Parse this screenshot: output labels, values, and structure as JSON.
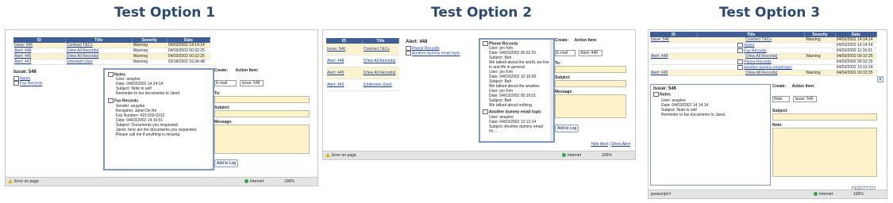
{
  "titles": [
    "Test Option 1",
    "Test Option 2",
    "Test Option 3"
  ],
  "common": {
    "status_error": "Error on page.",
    "status_error_js": "javascript://",
    "zone": "Internet",
    "zoom": "100%",
    "create_label": "Create:",
    "action_label": "Action Item:",
    "to_label": "To:",
    "subject_label": "Subject:",
    "message_label": "Message:",
    "note_label": "Note:",
    "add_to_log": "Add to Log"
  },
  "opt1": {
    "headers": [
      "ID",
      "Title",
      "Severity",
      "Date"
    ],
    "rows": [
      [
        "Issue: 546",
        "Contract T&Cs",
        "Warning",
        "04/03/2002 14:14:14"
      ],
      [
        "Alert: 448",
        "[View All Records]",
        "Warning",
        "04/03/2002 00:32:25"
      ],
      [
        "Alert: 445",
        "[View All Records]",
        "Warning",
        "04/03/2002 00:32:25"
      ],
      [
        "Alert: 443",
        "Unknown User",
        "Warning",
        "03/18/2002 16:34:48"
      ]
    ],
    "issue_title": "Issue: 546",
    "list": [
      "Notes",
      "Fax Records"
    ],
    "notes_header": "Notes",
    "notes_lines": [
      "User: anaylee",
      "Date: 04/03/2002 14:14:14",
      "Subject: Note to self",
      "Reminder to fax documents to Janet"
    ],
    "fax_header": "Fax Records",
    "fax_lines": [
      "Sender: anaylee",
      "Recipient: Janet De Re",
      "Fax Number: 415-555-0212",
      "Date: 04/03/2002 14:16:01",
      "Subject: Documents you requested",
      "Janet, here are the documents you requested.",
      "Please call me if anything is missing."
    ],
    "create_value": "E-mail",
    "action_value": "Issue: 546"
  },
  "opt2": {
    "headers": [
      "ID",
      "Title"
    ],
    "rows": [
      [
        "Issue: 546",
        "Contract T&Cs"
      ],
      [
        "Alert: 448",
        "[View All Records]"
      ],
      [
        "Alert: 445",
        "[View All Records]"
      ],
      [
        "Alert: 443",
        "[Unknown User]"
      ]
    ],
    "alert_title": "Alert: 448",
    "alert_links": [
      "Phone Records",
      "Another dummy email topic"
    ],
    "phone_header": "Phone Records",
    "phone_lines": [
      "User: jon Kim",
      "Date: 04/03/2002 00:32:25",
      "Subject: Bah",
      "We talked about the world, we live in and life in general.",
      "User: jon Kim",
      "Date: 04/03/2002 10:16:09",
      "Subject: Bah",
      "We talked about the weather.",
      "User: jon Kim",
      "Date: 04/03/2002 00:16:01",
      "Subject: Bah",
      "We talked about nothing."
    ],
    "email_header": "Another dummy email topic",
    "email_lines": [
      "User: anaylee",
      "Date: 04/03/2002 13:12:14",
      "Subject: Another dummy email",
      "Hi ..."
    ],
    "create_value": "E-mail",
    "action_value": "Alert: 448",
    "footer_links": [
      "Hide Alert",
      "Show Alert"
    ]
  },
  "opt3": {
    "headers": [
      "ID",
      "Title",
      "Severity",
      "Date"
    ],
    "rows": [
      [
        "Issue: 546",
        "Contract T&Cs",
        "Warning",
        "04/03/2002 14:14:14"
      ],
      [
        "",
        "Notes",
        "",
        "04/03/2002 14:14:14"
      ],
      [
        "",
        "Fax Records",
        "",
        "04/03/2002 11:16:01"
      ],
      [
        "Alert: 448",
        "[View All Records]",
        "Warning",
        "04/03/2002 00:32:25"
      ],
      [
        "",
        "Phone Records",
        "",
        "04/03/2002 00:32:25"
      ],
      [
        "",
        "Another dummy email topic",
        "",
        "04/03/2002 13:12:14"
      ],
      [
        "Alert: 445",
        "[View All Records]",
        "Warning",
        "04/04/2002 00:32:25"
      ]
    ],
    "issue_title": "Issue: 546",
    "notes_header": "Notes",
    "notes_lines": [
      "User: anaylee",
      "Date: 04/03/2002 14:14:14",
      "Subject: Note to self",
      "Reminder to fax documents to Janet."
    ],
    "create_value": "Note",
    "action_value": "Issue: 546"
  }
}
